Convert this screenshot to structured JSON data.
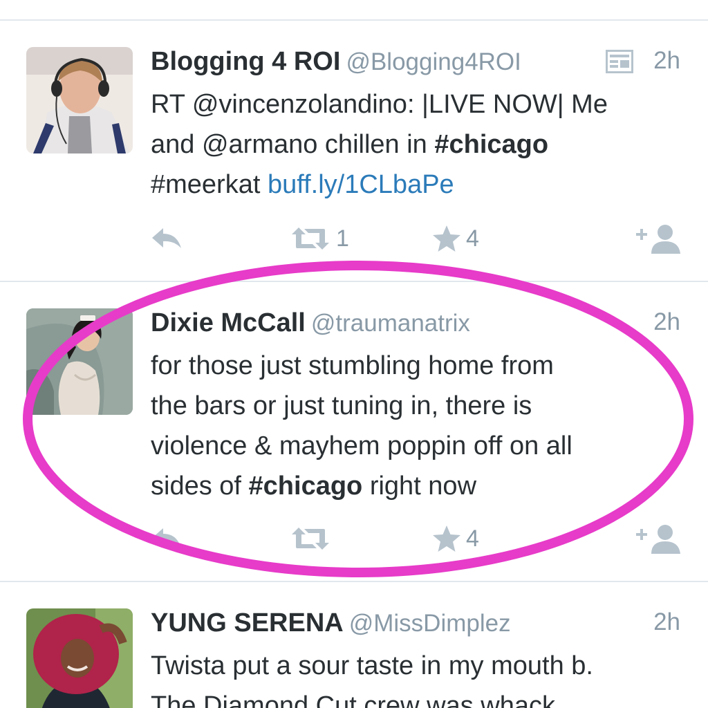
{
  "colors": {
    "divider": "#e1e8ed",
    "name": "#292f33",
    "meta": "#8899a6",
    "link": "#2b7bb9",
    "action_icon": "#b6c3cd",
    "annotation": "#e73bc9"
  },
  "tweets": [
    {
      "name": "Blogging 4 ROI",
      "handle": "@Blogging4ROI",
      "time": "2h",
      "has_summary_icon": true,
      "summary_icon": "summary-card-icon",
      "avatar_icon": "avatar-headphones-photo",
      "lines": {
        "l1": "RT @vincenzolandino: |LIVE NOW| Me",
        "l2_pre": "and @armano chillen in ",
        "l2_tag": "#chicago",
        "l3_tag": "#meerkat ",
        "l3_link": "buff.ly/1CLbaPe"
      },
      "retweets": "1",
      "favorites": "4"
    },
    {
      "name": "Dixie McCall",
      "handle": "@traumanatrix",
      "time": "2h",
      "avatar_icon": "avatar-pinup-photo",
      "lines": {
        "l1": "for those just stumbling home from",
        "l2": "the bars or just tuning in, there is",
        "l3": "violence & mayhem poppin off on all",
        "l4_pre": "sides of ",
        "l4_tag": "#chicago",
        "l4_post": " right now"
      },
      "retweets": "",
      "favorites": "4"
    },
    {
      "name": "YUNG SERENA",
      "handle": "@MissDimplez",
      "time": "2h",
      "avatar_icon": "avatar-portrait-photo",
      "lines": {
        "l1": "Twista put a sour taste in my mouth b.",
        "l2": "The Diamond Cut crew was whack"
      }
    }
  ]
}
